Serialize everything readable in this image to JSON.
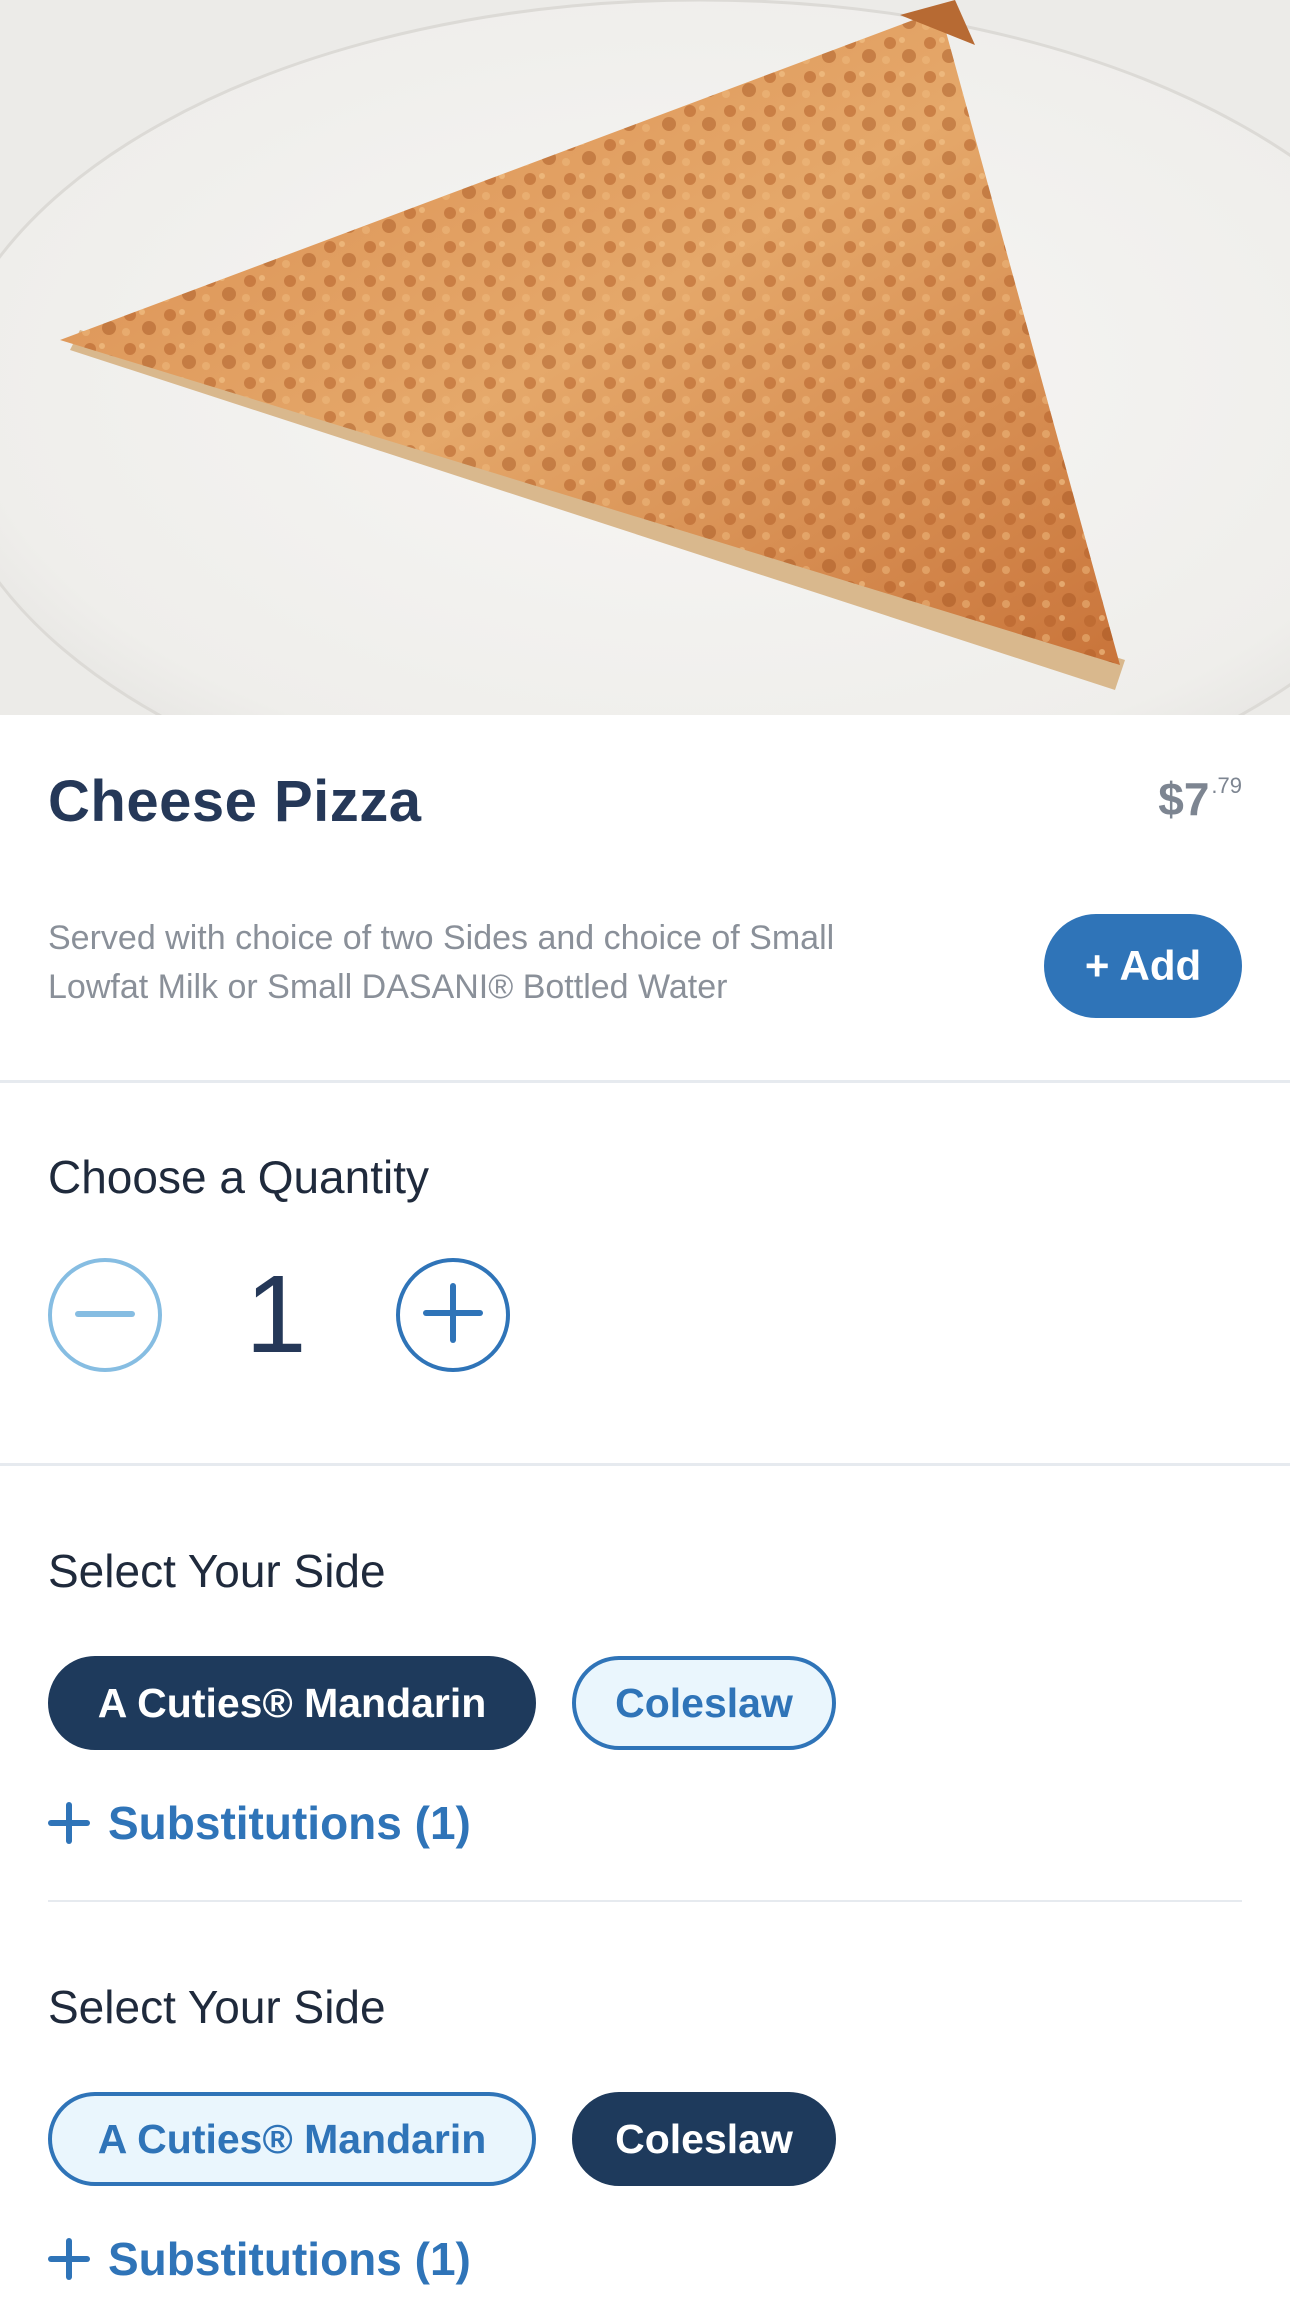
{
  "item": {
    "title": "Cheese Pizza",
    "price_dollars": "$7",
    "price_cents": ".79",
    "description": "Served with choice of two Sides and choice of Small Lowfat Milk or Small DASANI® Bottled Water",
    "add_label": "+ Add"
  },
  "quantity": {
    "heading": "Choose a Quantity",
    "value": "1",
    "minus_icon": "minus-circle-icon",
    "plus_icon": "plus-circle-icon"
  },
  "sides": [
    {
      "heading": "Select Your Side",
      "options": [
        {
          "label": "A Cuties® Mandarin",
          "selected": true
        },
        {
          "label": "Coleslaw",
          "selected": false
        }
      ],
      "substitutions_label": "Substitutions (1)"
    },
    {
      "heading": "Select Your Side",
      "options": [
        {
          "label": "A Cuties® Mandarin",
          "selected": false
        },
        {
          "label": "Coleslaw",
          "selected": true
        }
      ],
      "substitutions_label": "Substitutions (1)"
    }
  ],
  "colors": {
    "primary": "#2f74b8",
    "dark_navy": "#1e3a5c",
    "title": "#253858",
    "muted": "#8a9099"
  }
}
